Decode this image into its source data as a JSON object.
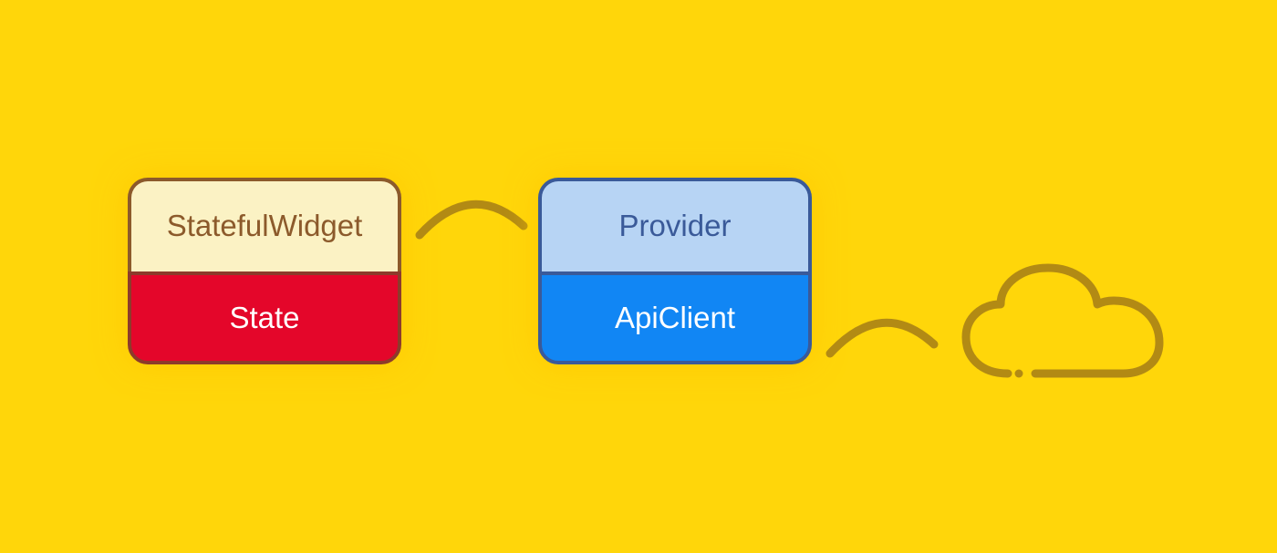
{
  "diagram": {
    "nodes": {
      "card_a": {
        "top_label": "StatefulWidget",
        "bottom_label": "State"
      },
      "card_b": {
        "top_label": "Provider",
        "bottom_label": "ApiClient"
      }
    },
    "connectors": [
      {
        "from": "card_a",
        "to": "card_b",
        "type": "arc"
      },
      {
        "from": "card_b",
        "to": "cloud",
        "type": "arc"
      }
    ],
    "terminal": {
      "type": "cloud"
    }
  },
  "colors": {
    "background": "#FFD60A",
    "arc": "#B28A14",
    "card_a_top_bg": "#FBF2C4",
    "card_a_top_border": "#8C5A2B",
    "card_a_bottom_bg": "#E4062A",
    "card_b_top_bg": "#B7D4F4",
    "card_b_top_border": "#3A5A99",
    "card_b_bottom_bg": "#1186F4"
  }
}
